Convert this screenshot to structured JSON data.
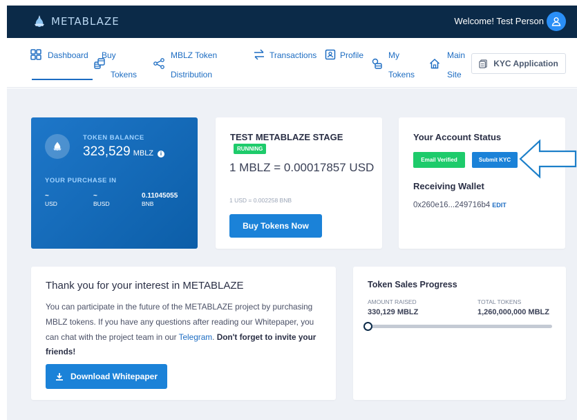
{
  "header": {
    "brand": "METABLAZE",
    "welcome": "Welcome! Test Person"
  },
  "nav": {
    "dashboard": "Dashboard",
    "buy_tokens_1": "Buy",
    "buy_tokens_2": "Tokens",
    "distribution_1": "MBLZ Token",
    "distribution_2": "Distribution",
    "transactions": "Transactions",
    "profile": "Profile",
    "my_tokens_1": "My",
    "my_tokens_2": "Tokens",
    "main_site_1": "Main",
    "main_site_2": "Site",
    "kyc_application": "KYC Application"
  },
  "balance": {
    "label": "TOKEN BALANCE",
    "value": "323,529",
    "unit": "MBLZ",
    "purchase_label": "YOUR PURCHASE IN",
    "usd_value": "~",
    "usd_label": "USD",
    "busd_value": "~",
    "busd_label": "BUSD",
    "bnb_value": "0.11045055",
    "bnb_label": "BNB"
  },
  "stage": {
    "title": "TEST METABLAZE STAGE",
    "status": "RUNNING",
    "rate": "1 MBLZ = 0.00017857 USD",
    "rate_sub": "1 USD = 0.002258 BNB",
    "buy_button": "Buy Tokens Now"
  },
  "account": {
    "title": "Your Account Status",
    "email_verified": "Email Verified",
    "submit_kyc": "Submit KYC",
    "wallet_title": "Receiving Wallet",
    "wallet_address": "0x260e16...249716b4",
    "edit": "EDIT"
  },
  "thanks": {
    "title": "Thank you for your interest in METABLAZE",
    "body_1": "You can participate in the future of the METABLAZE project by purchasing MBLZ tokens. If you have any questions after reading our Whitepaper, you can chat with the project team in our",
    "link": "Telegram",
    "body_2": ". ",
    "body_strong": "Don't forget to invite your friends!",
    "download_button": "Download Whitepaper"
  },
  "sales": {
    "title": "Token Sales Progress",
    "raised_label": "AMOUNT RAISED",
    "raised_value": "330,129 MBLZ",
    "total_label": "TOTAL TOKENS",
    "total_value": "1,260,000,000 MBLZ",
    "progress_fraction": 0.0
  },
  "colors": {
    "primary": "#1b82d8",
    "navy": "#0b2a48",
    "success": "#1ecb6b",
    "page_bg": "#eef1f6"
  },
  "icons": {
    "logo": "metablaze-logo-icon",
    "avatar": "user-icon",
    "dashboard": "grid-icon",
    "buy": "coins-icon",
    "distribution": "share-nodes-icon",
    "transactions": "swap-arrows-icon",
    "profile": "id-card-icon",
    "my_tokens": "coin-stack-icon",
    "main_site": "home-icon",
    "kyc": "document-icon",
    "download": "download-icon",
    "info": "info-icon",
    "arrow": "left-arrow-icon"
  }
}
